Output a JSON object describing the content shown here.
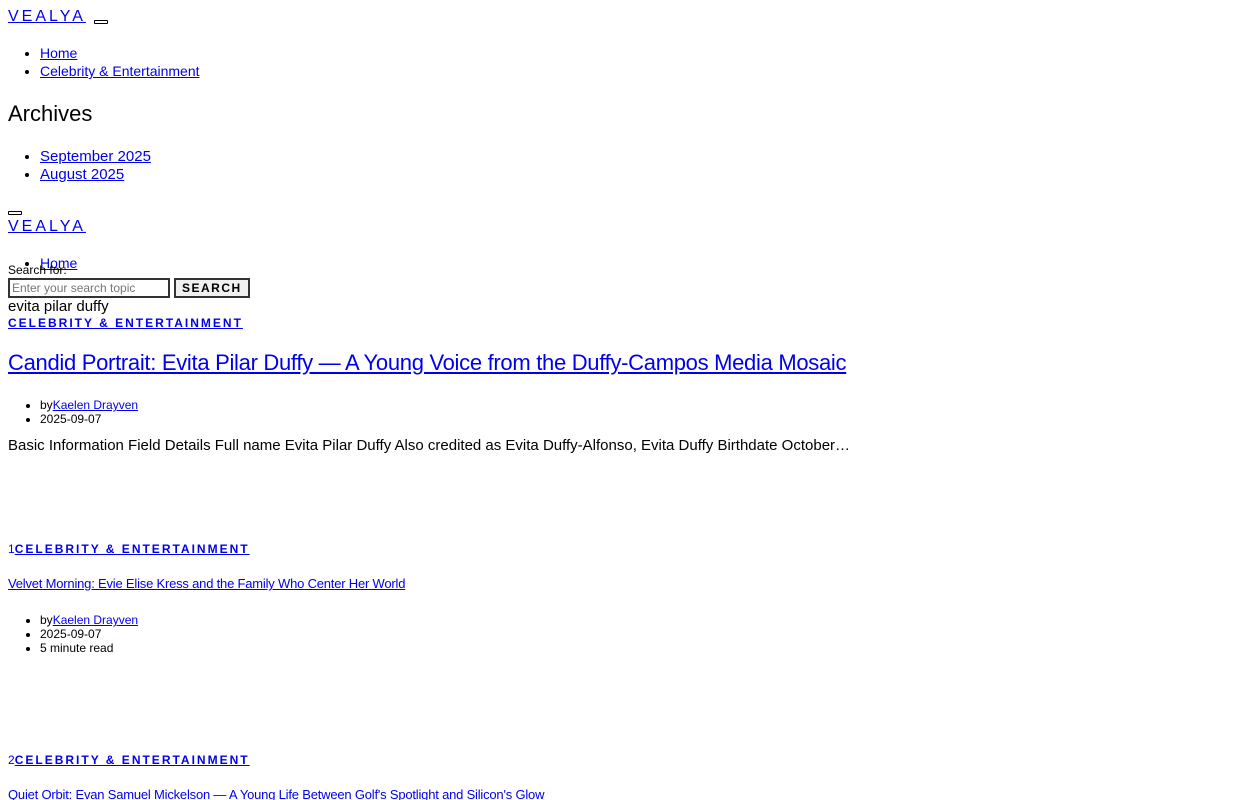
{
  "site": {
    "logo": "VEALYA"
  },
  "nav": {
    "items": [
      "Home",
      "Celebrity & Entertainment"
    ]
  },
  "archives": {
    "heading": "Archives",
    "items": [
      "September 2025",
      "August 2025"
    ]
  },
  "search": {
    "label": "Search for:",
    "placeholder": "Enter your search topic",
    "button": "SEARCH"
  },
  "hero": {
    "image_alt": "evita pilar duffy",
    "category": "CELEBRITY & ENTERTAINMENT",
    "title": "Candid Portrait: Evita Pilar Duffy — A Young Voice from the Duffy-Campos Media Mosaic",
    "by": "by",
    "author": "Kaelen Drayven",
    "date": "2025-09-07",
    "excerpt": "Basic Information Field Details Full name Evita Pilar Duffy Also credited as Evita Duffy-Alfonso, Evita Duffy Birthdate October…"
  },
  "posts": [
    {
      "number": "1",
      "category": "CELEBRITY & ENTERTAINMENT",
      "title": "Velvet Morning: Evie Elise Kress and the Family Who Center Her World",
      "by": "by",
      "author": "Kaelen Drayven",
      "date": "2025-09-07",
      "read_time": "5 minute read"
    },
    {
      "number": "2",
      "category": "CELEBRITY & ENTERTAINMENT",
      "title": "Quiet Orbit: Evan Samuel Mickelson — A Young Life Between Golf's Spotlight and Silicon's Glow"
    }
  ],
  "colors": {
    "link": "#0000ee",
    "text": "#000000",
    "background": "#ffffff"
  }
}
